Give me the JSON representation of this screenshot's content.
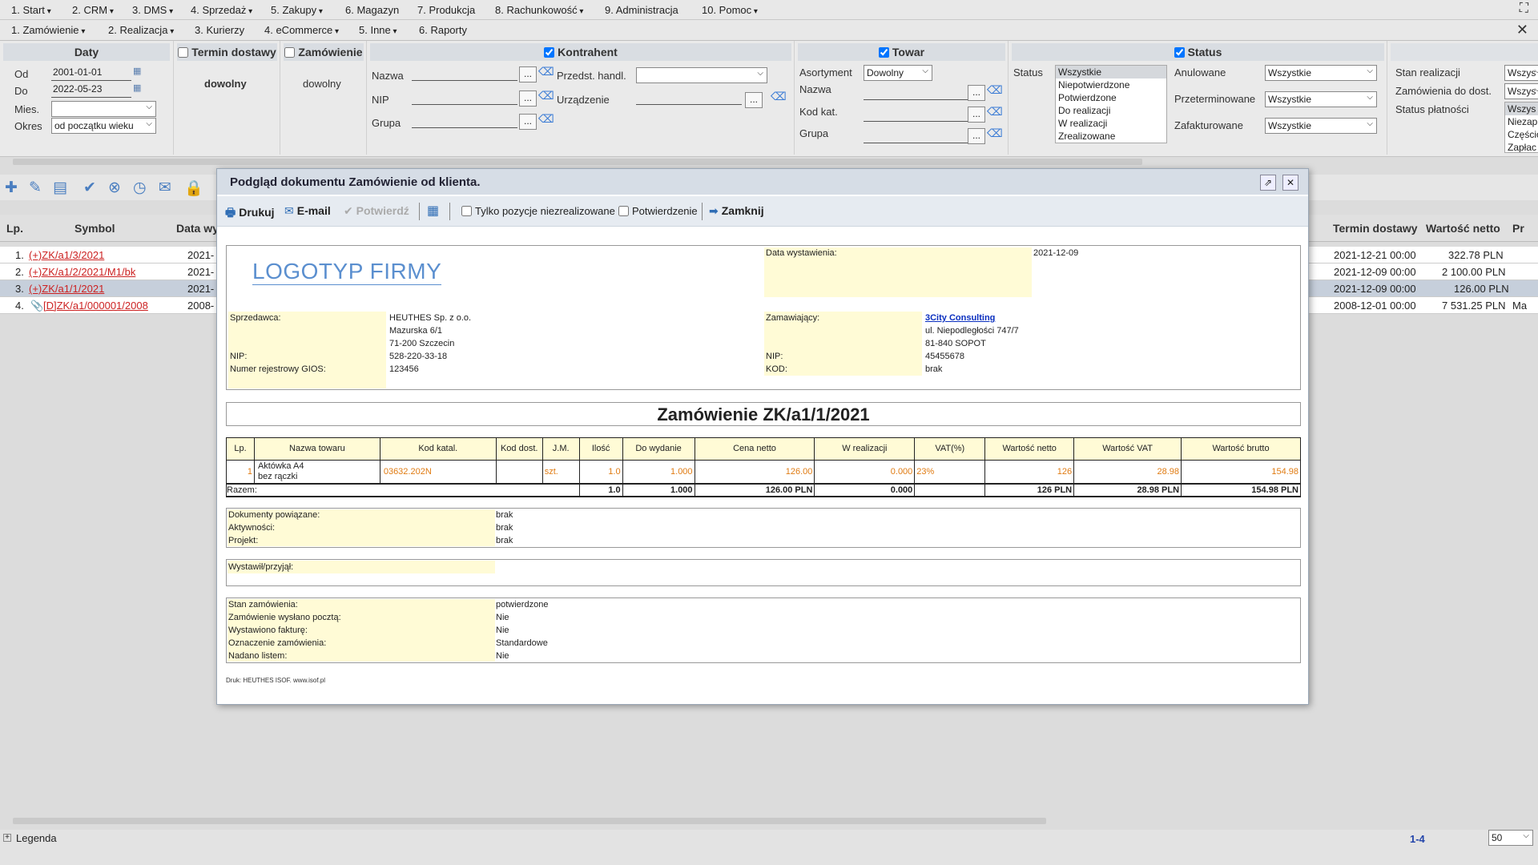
{
  "menu1": [
    "1. Start",
    "2. CRM",
    "3. DMS",
    "4. Sprzedaż",
    "5. Zakupy",
    "6. Magazyn",
    "7. Produkcja",
    "8. Rachunkowość",
    "9. Administracja",
    "10. Pomoc"
  ],
  "menu2": [
    "1. Zamówienie",
    "2. Realizacja",
    "3. Kurierzy",
    "4. eCommerce",
    "5. Inne",
    "6. Raporty"
  ],
  "filters": {
    "daty": {
      "title": "Daty",
      "od_label": "Od",
      "od": "2001-01-01",
      "do_label": "Do",
      "do": "2022-05-23",
      "mies_label": "Mies.",
      "mies": "",
      "okres_label": "Okres",
      "okres": "od początku wieku"
    },
    "termin": {
      "title": "Termin dostawy",
      "value": "dowolny"
    },
    "zamowienie": {
      "title": "Zamówienie",
      "value": "dowolny"
    },
    "kontrahent": {
      "title": "Kontrahent",
      "nazwa": "Nazwa",
      "nip": "NIP",
      "grupa": "Grupa",
      "przedst": "Przedst. handl.",
      "urzadzenie": "Urządzenie"
    },
    "towar": {
      "title": "Towar",
      "asortyment_label": "Asortyment",
      "asortyment": "Dowolny",
      "nazwa": "Nazwa",
      "kodkat": "Kod kat.",
      "grupa": "Grupa"
    },
    "status": {
      "title": "Status",
      "label": "Status",
      "options": [
        "Wszystkie",
        "Niepotwierdzone",
        "Potwierdzone",
        "Do realizacji",
        "W realizacji",
        "Zrealizowane"
      ],
      "anulowane_label": "Anulowane",
      "anulowane": "Wszystkie",
      "przeterm_label": "Przeterminowane",
      "przeterm": "Wszystkie",
      "zafakt_label": "Zafakturowane",
      "zafakt": "Wszystkie"
    },
    "extra": {
      "stan_label": "Stan realizacji",
      "stan": "Wszys",
      "zamdost_label": "Zamówienia do dost.",
      "zamdost": "Wszys",
      "platnosci_label": "Status płatności",
      "platnosci_opts": [
        "Wszys",
        "Niezap",
        "Częścio",
        "Zapłac"
      ]
    }
  },
  "grid": {
    "headers": {
      "lp": "Lp.",
      "symbol": "Symbol",
      "data": "Data wy",
      "termin": "Termin dostawy",
      "netto": "Wartość netto",
      "pr": "Pr"
    },
    "rows": [
      {
        "lp": "1.",
        "symbol": "(+)ZK/a1/3/2021",
        "data": "2021-",
        "termin": "2021-12-21 00:00",
        "netto": "322.78 PLN",
        "pr": ""
      },
      {
        "lp": "2.",
        "symbol": "(+)ZK/a1/2/2021/M1/bk",
        "data": "2021-",
        "termin": "2021-12-09 00:00",
        "netto": "2 100.00 PLN",
        "pr": ""
      },
      {
        "lp": "3.",
        "symbol": "(+)ZK/a1/1/2021",
        "data": "2021-",
        "termin": "2021-12-09 00:00",
        "netto": "126.00 PLN",
        "pr": ""
      },
      {
        "lp": "4.",
        "symbol": "[D]ZK/a1/000001/2008",
        "data": "2008-",
        "termin": "2008-12-01 00:00",
        "netto": "7 531.25 PLN",
        "pr": "Ma"
      }
    ]
  },
  "modal": {
    "title": "Podgląd dokumentu Zamówienie od klienta.",
    "toolbar": {
      "drukuj": "Drukuj",
      "email": "E-mail",
      "potwierdz": "Potwierdź",
      "niezreal": "Tylko pozycje niezrealizowane",
      "potwierdzenie": "Potwierdzenie",
      "zamknij": "Zamknij"
    },
    "doc": {
      "logo": "LOGOTYP FIRMY",
      "data_wyst_label": "Data wystawienia:",
      "data_wyst": "2021-12-09",
      "seller_label": "Sprzedawca:",
      "seller": [
        "HEUTHES Sp. z o.o.",
        "Mazurska 6/1",
        "71-200 Szczecin"
      ],
      "seller_nip_label": "NIP:",
      "seller_nip": "528-220-33-18",
      "gios_label": "Numer rejestrowy GIOS:",
      "gios": "123456",
      "buyer_label": "Zamawiający:",
      "buyer_name": "3City Consulting",
      "buyer": [
        "ul. Niepodległości 747/7",
        "81-840 SOPOT"
      ],
      "buyer_nip_label": "NIP:",
      "buyer_nip": "45455678",
      "kod_label": "KOD:",
      "kod": "brak",
      "title": "Zamówienie ZK/a1/1/2021",
      "table_headers": [
        "Lp.",
        "Nazwa towaru",
        "Kod katal.",
        "Kod dost.",
        "J.M.",
        "Ilość",
        "Do wydanie",
        "Cena netto",
        "W realizacji",
        "VAT(%)",
        "Wartość netto",
        "Wartość VAT",
        "Wartość brutto"
      ],
      "items": [
        {
          "lp": "1",
          "nazwa1": "Aktówka A4",
          "nazwa2": "bez rączki",
          "kod": "03632.202N",
          "kod_dost": "",
          "jm": "szt.",
          "ilosc": "1.0",
          "do_wyd": "1.000",
          "cena": "126.00",
          "wreal": "0.000",
          "vat": "23%",
          "netto": "126",
          "vat_val": "28.98",
          "brutto": "154.98"
        }
      ],
      "sum": {
        "label": "Razem:",
        "ilosc": "1.0",
        "do_wyd": "1.000",
        "cena": "126.00 PLN",
        "wreal": "0.000",
        "netto": "126 PLN",
        "vat_val": "28.98 PLN",
        "brutto": "154.98 PLN"
      },
      "related": [
        {
          "label": "Dokumenty powiązane:",
          "value": "brak"
        },
        {
          "label": "Aktywności:",
          "value": "brak"
        },
        {
          "label": "Projekt:",
          "value": "brak"
        }
      ],
      "wystawil_label": "Wystawił/przyjął:",
      "info": [
        {
          "label": "Stan zamówienia:",
          "value": "potwierdzone"
        },
        {
          "label": "Zamówienie wysłano pocztą:",
          "value": "Nie"
        },
        {
          "label": "Wystawiono fakturę:",
          "value": "Nie"
        },
        {
          "label": "Oznaczenie zamówienia:",
          "value": "Standardowe"
        },
        {
          "label": "Nadano listem:",
          "value": "Nie"
        }
      ],
      "print": "Druk: HEUTHES ISOF. www.isof.pl"
    }
  },
  "statusbar": {
    "legenda": "Legenda",
    "range": "1-4",
    "pagesize": "50"
  },
  "colors": {
    "accent": "#2f6db5",
    "link": "#cc2222",
    "highlight": "#fffbd6",
    "orange": "#e07b12"
  }
}
